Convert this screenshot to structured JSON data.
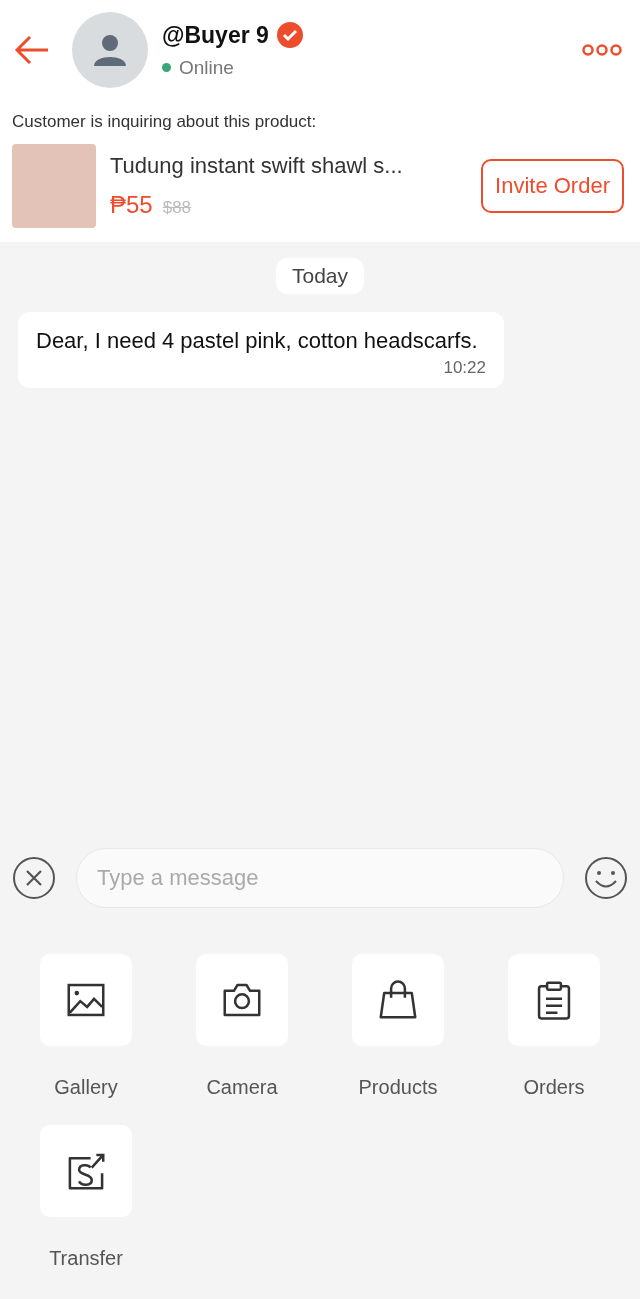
{
  "header": {
    "name": "@Buyer 9",
    "verified": true,
    "status": "Online",
    "online": true
  },
  "inquiry": {
    "label": "Customer is inquiring about this product:",
    "product": {
      "title": "Tudung instant swift shawl s...",
      "price": "₱55",
      "original_price": "$88",
      "button": "Invite Order"
    }
  },
  "date_divider": "Today",
  "messages": [
    {
      "text": "Dear, I need 4 pastel pink, cotton headscarfs.",
      "time": "10:22"
    }
  ],
  "composer": {
    "placeholder": "Type a message"
  },
  "actions": [
    {
      "kind": "gallery",
      "label": "Gallery"
    },
    {
      "kind": "camera",
      "label": "Camera"
    },
    {
      "kind": "products",
      "label": "Products"
    },
    {
      "kind": "orders",
      "label": "Orders"
    },
    {
      "kind": "transfer",
      "label": "Transfer"
    }
  ]
}
